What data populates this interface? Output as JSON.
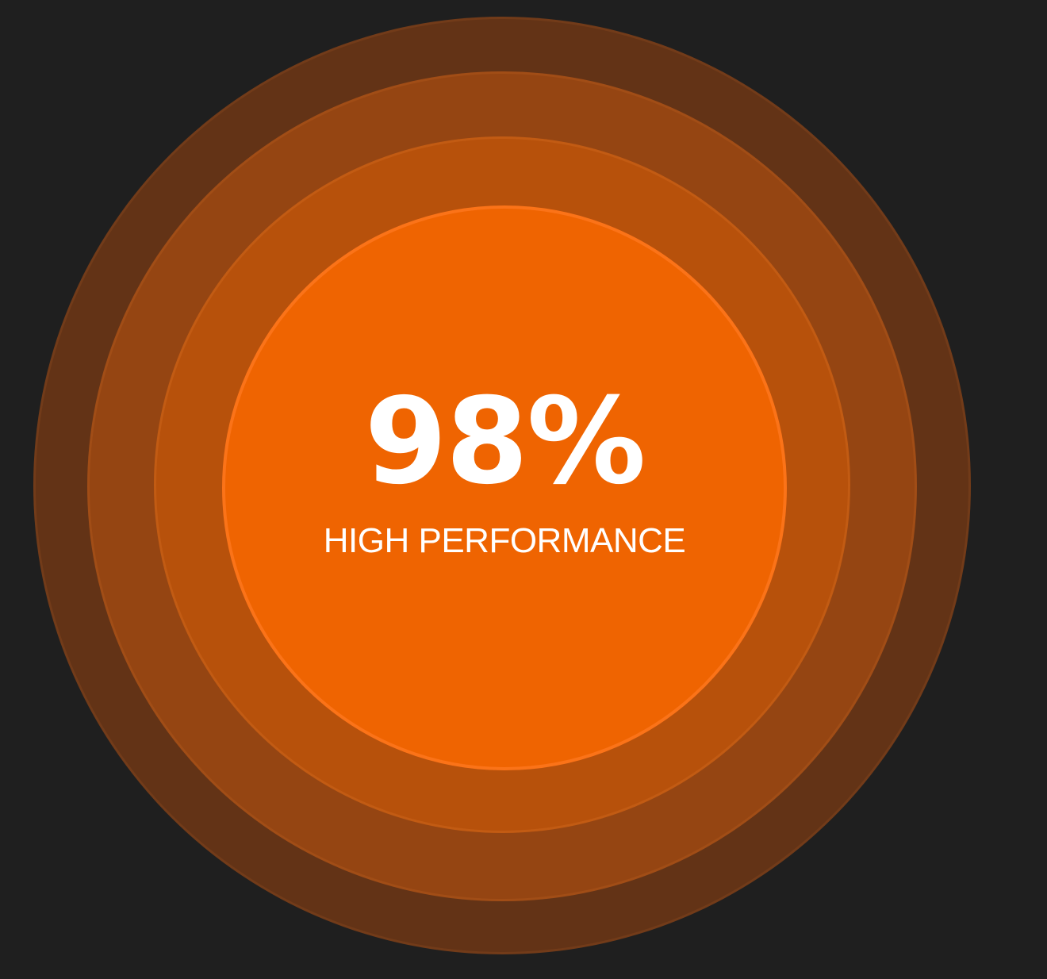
{
  "metric": {
    "value": "98%",
    "label": "HIGH PERFORMANCE",
    "level": 0.98
  },
  "colors": {
    "background": "#1f1f1f",
    "ring_outer": "#633316",
    "ring_second": "#954512",
    "ring_third": "#b7510b",
    "ring_inner": "#ef6401",
    "text": "#ffffff"
  }
}
